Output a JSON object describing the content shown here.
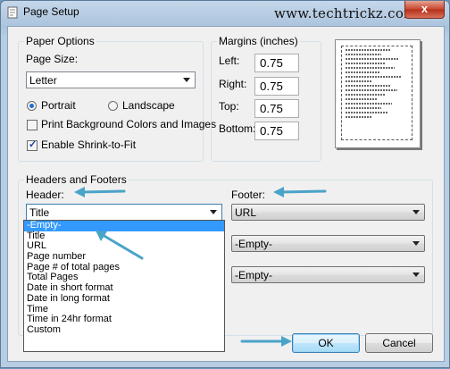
{
  "window": {
    "title": "Page Setup",
    "watermark": "www.techtrickz.com",
    "close_label": "x"
  },
  "paper_options": {
    "legend": "Paper Options",
    "page_size_label": "Page Size:",
    "page_size_value": "Letter",
    "portrait_label": "Portrait",
    "landscape_label": "Landscape",
    "orientation_selected": "Portrait",
    "print_bg_label": "Print Background Colors and Images",
    "print_bg_checked": false,
    "shrink_label": "Enable Shrink-to-Fit",
    "shrink_checked": true
  },
  "margins": {
    "legend": "Margins (inches)",
    "left_label": "Left:",
    "left_value": "0.75",
    "right_label": "Right:",
    "right_value": "0.75",
    "top_label": "Top:",
    "top_value": "0.75",
    "bottom_label": "Bottom:",
    "bottom_value": "0.75"
  },
  "headers_footers": {
    "legend": "Headers and Footers",
    "header_label": "Header:",
    "header_value": "Title",
    "footer_label": "Footer:",
    "footer_value_1": "URL",
    "footer_value_2": "-Empty-",
    "footer_value_3": "-Empty-",
    "header_options": [
      "-Empty-",
      "Title",
      "URL",
      "Page number",
      "Page # of total pages",
      "Total Pages",
      "Date in short format",
      "Date in long format",
      "Time",
      "Time in 24hr format",
      "Custom"
    ],
    "highlighted_option": "-Empty-"
  },
  "buttons": {
    "ok": "OK",
    "cancel": "Cancel"
  },
  "colors": {
    "arrow": "#4aa3c9",
    "selection": "#3399ff"
  }
}
